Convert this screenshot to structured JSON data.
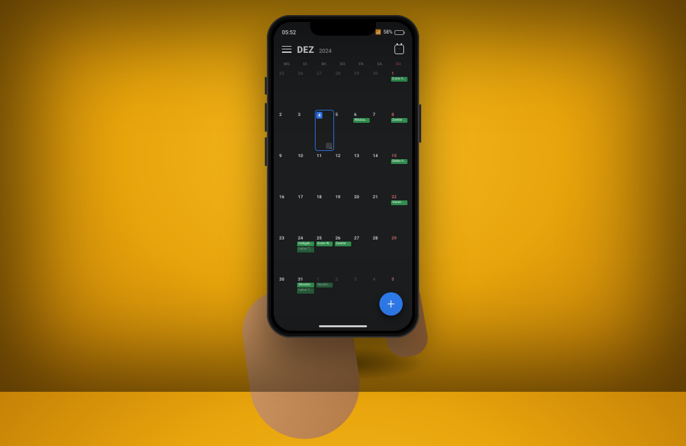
{
  "status": {
    "time": "05:52",
    "battery_pct": "58%",
    "signal_icon": "signal-icon",
    "alarm_icon": "alarm-icon"
  },
  "header": {
    "month": "DEZ",
    "year": "2024"
  },
  "dow": [
    "MO.",
    "DI.",
    "MI.",
    "DO.",
    "FR.",
    "SA.",
    "SO."
  ],
  "weeks": [
    {
      "days": [
        {
          "num": "25",
          "other": true
        },
        {
          "num": "26",
          "other": true
        },
        {
          "num": "27",
          "other": true
        },
        {
          "num": "28",
          "other": true
        },
        {
          "num": "29",
          "other": true
        },
        {
          "num": "30",
          "other": true
        },
        {
          "num": "1",
          "sun": true,
          "events": [
            {
              "label": "Erster Advent"
            }
          ]
        }
      ]
    },
    {
      "days": [
        {
          "num": "2"
        },
        {
          "num": "3"
        },
        {
          "num": "4",
          "today": true,
          "note": true
        },
        {
          "num": "5"
        },
        {
          "num": "6",
          "events": [
            {
              "label": "Nikolaustag"
            }
          ]
        },
        {
          "num": "7"
        },
        {
          "num": "8",
          "sun": true,
          "events": [
            {
              "label": "Zweiter Advent"
            }
          ]
        }
      ]
    },
    {
      "days": [
        {
          "num": "9"
        },
        {
          "num": "10"
        },
        {
          "num": "11"
        },
        {
          "num": "12"
        },
        {
          "num": "13"
        },
        {
          "num": "14"
        },
        {
          "num": "15",
          "sun": true,
          "events": [
            {
              "label": "Dritter Advent"
            }
          ]
        }
      ]
    },
    {
      "days": [
        {
          "num": "16"
        },
        {
          "num": "17"
        },
        {
          "num": "18"
        },
        {
          "num": "19"
        },
        {
          "num": "20"
        },
        {
          "num": "21"
        },
        {
          "num": "22",
          "sun": true,
          "events": [
            {
              "label": "Vierter Advent"
            }
          ]
        }
      ]
    },
    {
      "days": [
        {
          "num": "23"
        },
        {
          "num": "24",
          "events": [
            {
              "label": "Heiligabend"
            },
            {
              "label": "halber Tag",
              "dim": true
            }
          ]
        },
        {
          "num": "25",
          "events": [
            {
              "label": "Erster Weihnachtstag"
            }
          ]
        },
        {
          "num": "26",
          "events": [
            {
              "label": "Zweiter Weihnachtstag"
            }
          ]
        },
        {
          "num": "27"
        },
        {
          "num": "28"
        },
        {
          "num": "29",
          "sun": true
        }
      ]
    },
    {
      "days": [
        {
          "num": "30"
        },
        {
          "num": "31",
          "events": [
            {
              "label": "Silvester"
            },
            {
              "label": "halber Tag",
              "dim": true
            }
          ]
        },
        {
          "num": "1",
          "other": true,
          "events": [
            {
              "label": "Neujahrstag",
              "dim": true
            }
          ]
        },
        {
          "num": "2",
          "other": true
        },
        {
          "num": "3",
          "other": true
        },
        {
          "num": "4",
          "other": true
        },
        {
          "num": "5",
          "other": true,
          "sun": true
        }
      ]
    }
  ],
  "fab": {
    "label": "+"
  }
}
